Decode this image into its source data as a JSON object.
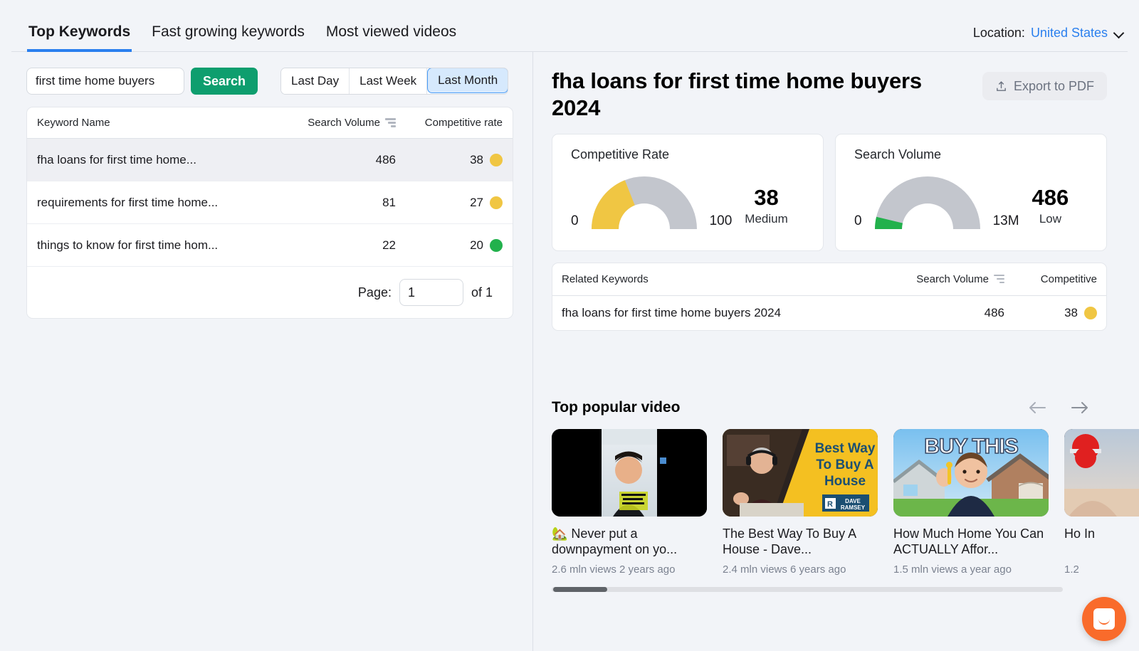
{
  "header": {
    "tabs": [
      {
        "label": "Top Keywords",
        "active": true
      },
      {
        "label": "Fast growing keywords",
        "active": false
      },
      {
        "label": "Most viewed videos",
        "active": false
      }
    ],
    "location_label": "Location:",
    "location_value": "United States"
  },
  "controls": {
    "search_value": "first time home buyers",
    "search_placeholder": "first time home buyers",
    "search_button": "Search",
    "ranges": [
      {
        "label": "Last Day",
        "active": false
      },
      {
        "label": "Last Week",
        "active": false
      },
      {
        "label": "Last Month",
        "active": true
      }
    ]
  },
  "keywords_table": {
    "columns": {
      "name": "Keyword Name",
      "volume": "Search Volume",
      "rate": "Competitive rate"
    },
    "rows": [
      {
        "name": "fha loans for first time home...",
        "volume": "486",
        "rate": "38",
        "color": "#f0c643",
        "selected": true
      },
      {
        "name": "requirements for first time home...",
        "volume": "81",
        "rate": "27",
        "color": "#f0c643",
        "selected": false
      },
      {
        "name": "things to know for first time hom...",
        "volume": "22",
        "rate": "20",
        "color": "#22b14c",
        "selected": false
      }
    ],
    "pager": {
      "label": "Page:",
      "value": "1",
      "of": "of 1"
    }
  },
  "detail": {
    "title": "fha loans for first time home buyers 2024",
    "export_label": "Export to PDF"
  },
  "chart_data": [
    {
      "type": "gauge",
      "title": "Competitive Rate",
      "value": 38,
      "min": 0,
      "max": 100,
      "min_label": "0",
      "max_label": "100",
      "value_label": "38",
      "rating": "Medium",
      "fill_color": "#f0c643",
      "track_color": "#c3c6cd"
    },
    {
      "type": "gauge",
      "title": "Search Volume",
      "value": 486,
      "min": 0,
      "max": 13000000,
      "min_label": "0",
      "max_label": "13M",
      "value_label": "486",
      "rating": "Low",
      "fill_color": "#22b14c",
      "track_color": "#c3c6cd",
      "fill_fraction": 0.075
    }
  ],
  "related_table": {
    "columns": {
      "name": "Related Keywords",
      "volume": "Search Volume",
      "competitive": "Competitive"
    },
    "rows": [
      {
        "name": "fha loans for first time home buyers 2024",
        "volume": "486",
        "competitive": "38",
        "color": "#f0c643"
      }
    ]
  },
  "videos": {
    "title": "Top popular video",
    "prev_icon": "arrow-left-icon",
    "next_icon": "arrow-right-icon",
    "items": [
      {
        "title": "🏡 Never put a downpayment on yo...",
        "meta": "2.6 mln views 2 years ago",
        "thumb_style": "shorts-portrait",
        "overlay_text": ""
      },
      {
        "title": "The Best Way To Buy A House - Dave...",
        "meta": "2.4 mln views 6 years ago",
        "thumb_style": "dave-ramsey",
        "overlay_text": "Best Way To Buy A House"
      },
      {
        "title": "How Much Home You Can ACTUALLY Affor...",
        "meta": "1.5 mln views a year ago",
        "thumb_style": "buy-this",
        "overlay_text": "BUY THIS"
      },
      {
        "title": "Ho In",
        "meta": "1.2",
        "thumb_style": "clipped",
        "overlay_text": ""
      }
    ]
  }
}
